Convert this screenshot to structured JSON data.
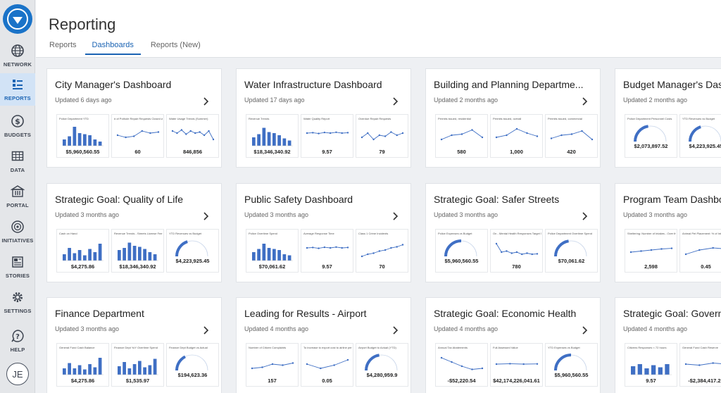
{
  "sidebar": {
    "items": [
      {
        "key": "network",
        "label": "NETWORK",
        "icon": "globe-icon"
      },
      {
        "key": "reports",
        "label": "REPORTS",
        "icon": "reports-icon",
        "active": true
      },
      {
        "key": "budgets",
        "label": "BUDGETS",
        "icon": "dollar-icon"
      },
      {
        "key": "data",
        "label": "DATA",
        "icon": "data-icon"
      },
      {
        "key": "portal",
        "label": "PORTAL",
        "icon": "portal-icon"
      },
      {
        "key": "initiatives",
        "label": "INITIATIVES",
        "icon": "initiatives-icon"
      },
      {
        "key": "stories",
        "label": "STORIES",
        "icon": "stories-icon"
      },
      {
        "key": "settings",
        "label": "SETTINGS",
        "icon": "gear-icon"
      },
      {
        "key": "help",
        "label": "HELP",
        "icon": "help-icon"
      }
    ],
    "avatar_initials": "JE"
  },
  "header": {
    "title": "Reporting",
    "tabs": [
      {
        "label": "Reports"
      },
      {
        "label": "Dashboards",
        "active": true
      },
      {
        "label": "Reports (New)"
      }
    ]
  },
  "colors": {
    "accent": "#1a63b3",
    "bar": "#3f6fc4"
  },
  "cards": [
    {
      "title": "City Manager's Dashboard",
      "updated": "Updated 6 days ago",
      "thumbs": [
        {
          "title": "Police Department YTD",
          "value": "$5,960,560.55",
          "chart": "bar",
          "series": [
            0.3,
            0.45,
            0.9,
            0.6,
            0.55,
            0.5,
            0.3,
            0.2
          ]
        },
        {
          "title": "# of Pothole Repair Requests Closed within SLA",
          "value": "60",
          "chart": "line",
          "series": [
            0.5,
            0.4,
            0.45,
            0.7,
            0.6,
            0.65
          ]
        },
        {
          "title": "Water Usage Trends (Summer)",
          "value": "846,856",
          "chart": "line",
          "series": [
            0.7,
            0.6,
            0.75,
            0.55,
            0.7,
            0.6,
            0.65,
            0.5,
            0.7,
            0.3
          ]
        }
      ]
    },
    {
      "title": "Water Infrastructure Dashboard",
      "updated": "Updated 17 days ago",
      "thumbs": [
        {
          "title": "Revenue Trends",
          "value": "$18,346,340.92",
          "chart": "bar",
          "series": [
            0.4,
            0.55,
            0.85,
            0.65,
            0.6,
            0.5,
            0.35,
            0.25
          ]
        },
        {
          "title": "Water Quality Report",
          "value": "9.57",
          "chart": "line",
          "series": [
            0.6,
            0.62,
            0.58,
            0.63,
            0.6,
            0.64,
            0.6,
            0.62
          ]
        },
        {
          "title": "Overdue Repair Requests",
          "value": "79",
          "chart": "line",
          "series": [
            0.4,
            0.6,
            0.3,
            0.5,
            0.45,
            0.65,
            0.5,
            0.6
          ]
        }
      ]
    },
    {
      "title": "Building and Planning Departme...",
      "updated": "Updated 2 months ago",
      "thumbs": [
        {
          "title": "Permits issued, residential",
          "value": "580",
          "chart": "line",
          "series": [
            0.3,
            0.5,
            0.55,
            0.75,
            0.4
          ]
        },
        {
          "title": "Permits issued, overall",
          "value": "1,000",
          "chart": "line",
          "series": [
            0.4,
            0.5,
            0.8,
            0.6,
            0.45
          ]
        },
        {
          "title": "Permits issued, commercial",
          "value": "420",
          "chart": "line",
          "series": [
            0.35,
            0.5,
            0.55,
            0.7,
            0.3
          ]
        }
      ]
    },
    {
      "title": "Budget Manager's Dashboard",
      "updated": "Updated 2 months ago",
      "thumbs": [
        {
          "title": "Police Department Personnel Costs",
          "value": "$2,073,897.52",
          "chart": "gauge",
          "series": [
            0.45
          ]
        },
        {
          "title": "YTD Revenues vs Budget",
          "value": "$4,223,925.45",
          "chart": "gauge",
          "series": [
            0.4
          ]
        },
        {
          "title": "",
          "value": "",
          "chart": "gauge",
          "series": [
            0.5
          ]
        }
      ]
    },
    {
      "title": "Strategic Goal: Quality of Life",
      "updated": "Updated 3 months ago",
      "thumbs": [
        {
          "title": "Cash on Hand",
          "value": "$4,275.86",
          "chart": "bar",
          "series": [
            0.3,
            0.6,
            0.35,
            0.5,
            0.25,
            0.55,
            0.4,
            0.8
          ]
        },
        {
          "title": "Revenue Trends - Streets License Fee",
          "value": "$18,346,340.92",
          "chart": "bar",
          "series": [
            0.5,
            0.6,
            0.85,
            0.7,
            0.65,
            0.55,
            0.4,
            0.3
          ]
        },
        {
          "title": "YTD Revenues vs Budget",
          "value": "$4,223,925.45",
          "chart": "gauge",
          "series": [
            0.4
          ]
        }
      ]
    },
    {
      "title": "Public Safety Dashboard",
      "updated": "Updated 3 months ago",
      "thumbs": [
        {
          "title": "Police Overtime Spend",
          "value": "$70,061.62",
          "chart": "bar",
          "series": [
            0.4,
            0.55,
            0.8,
            0.6,
            0.55,
            0.5,
            0.3,
            0.25
          ]
        },
        {
          "title": "Average Response Time",
          "value": "9.57",
          "chart": "line",
          "series": [
            0.6,
            0.62,
            0.58,
            0.63,
            0.6,
            0.64,
            0.6,
            0.62
          ]
        },
        {
          "title": "Class 1 Crime Incidents",
          "value": "70",
          "chart": "line",
          "series": [
            0.2,
            0.3,
            0.35,
            0.45,
            0.5,
            0.6,
            0.65,
            0.75
          ]
        }
      ]
    },
    {
      "title": "Strategic Goal: Safer Streets",
      "updated": "Updated 3 months ago",
      "thumbs": [
        {
          "title": "Police Expenses vs Budget",
          "value": "$5,960,560.55",
          "chart": "gauge",
          "series": [
            0.5
          ]
        },
        {
          "title": "On - Mental Health Responses Target 50% Increase",
          "value": "780",
          "chart": "line",
          "series": [
            0.8,
            0.4,
            0.45,
            0.35,
            0.4,
            0.3,
            0.35,
            0.3,
            0.32
          ]
        },
        {
          "title": "Police Department Overtime Spend",
          "value": "$70,061.62",
          "chart": "gauge",
          "series": [
            0.45
          ]
        }
      ]
    },
    {
      "title": "Program Team Dashboard",
      "updated": "Updated 3 months ago",
      "thumbs": [
        {
          "title": "Sheltering: Number of Intakes - Over the Counter",
          "value": "2,598",
          "chart": "line",
          "series": [
            0.4,
            0.45,
            0.5,
            0.55,
            0.58
          ]
        },
        {
          "title": "Animal Pet Placement: % of Intakes Animals Transferred to Re",
          "value": "0.45",
          "chart": "line",
          "series": [
            0.3,
            0.5,
            0.6,
            0.55
          ]
        },
        {
          "title": "",
          "value": "",
          "chart": "line",
          "series": [
            0.4,
            0.5
          ]
        }
      ]
    },
    {
      "title": "Finance Department",
      "updated": "Updated 3 months ago",
      "thumbs": [
        {
          "title": "General Fund Cash Balance",
          "value": "$4,275.86",
          "chart": "bar",
          "series": [
            0.3,
            0.55,
            0.3,
            0.45,
            0.25,
            0.5,
            0.35,
            0.8
          ]
        },
        {
          "title": "Finance Dept YoY Overtime Spend",
          "value": "$1,535.97",
          "chart": "bar",
          "series": [
            0.4,
            0.6,
            0.3,
            0.5,
            0.65,
            0.35,
            0.45,
            0.75
          ]
        },
        {
          "title": "Finance Dept Budget vs Actual",
          "value": "$194,623.36",
          "chart": "gauge",
          "series": [
            0.35
          ]
        }
      ]
    },
    {
      "title": "Leading for Results - Airport",
      "updated": "Updated 4 months ago",
      "thumbs": [
        {
          "title": "Number of Citizen Complaints",
          "value": "157",
          "chart": "line",
          "series": [
            0.3,
            0.35,
            0.5,
            0.45,
            0.55
          ]
        },
        {
          "title": "To increase to export cost to airline per boarding passenger",
          "value": "0.05",
          "chart": "line",
          "series": [
            0.5,
            0.3,
            0.45,
            0.7
          ]
        },
        {
          "title": "Airport Budget to Actual (YTD)",
          "value": "$4,280,959.9",
          "chart": "gauge",
          "series": [
            0.45
          ]
        }
      ]
    },
    {
      "title": "Strategic Goal: Economic Health",
      "updated": "Updated 4 months ago",
      "thumbs": [
        {
          "title": "Annual Tax Abatements",
          "value": "-$52,220.54",
          "chart": "line",
          "series": [
            0.8,
            0.6,
            0.4,
            0.25,
            0.3
          ]
        },
        {
          "title": "Full Assessed Value",
          "value": "$42,174,226,041.61",
          "chart": "line",
          "series": [
            0.5,
            0.52,
            0.5,
            0.51
          ]
        },
        {
          "title": "YTD Expenses vs Budget",
          "value": "$5,960,560.55",
          "chart": "gauge",
          "series": [
            0.5
          ]
        }
      ]
    },
    {
      "title": "Strategic Goal: Governance",
      "updated": "Updated 4 months ago",
      "thumbs": [
        {
          "title": "Citizens Responses < 72 hours",
          "value": "9.57",
          "chart": "bar",
          "series": [
            0.4,
            0.5,
            0.3,
            0.45,
            0.35,
            0.5
          ]
        },
        {
          "title": "General Fund Cash Reserve",
          "value": "-$2,384,417.21",
          "chart": "line",
          "series": [
            0.5,
            0.45,
            0.55,
            0.5
          ]
        },
        {
          "title": "",
          "value": "",
          "chart": "line",
          "series": [
            0.5,
            0.5
          ]
        }
      ]
    }
  ]
}
